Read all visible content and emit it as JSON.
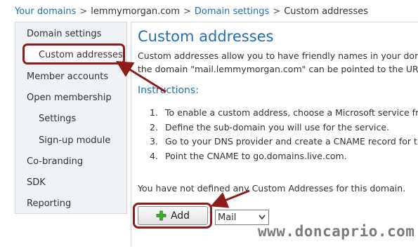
{
  "breadcrumb": {
    "your_domains": "Your domains",
    "sep1": ">",
    "domain": "lemmymorgan.com",
    "sep2": ">",
    "domain_settings": "Domain settings",
    "sep3": ">",
    "current": "Custom addresses"
  },
  "sidebar": {
    "items": [
      {
        "label": "Domain settings"
      },
      {
        "label": "Custom addresses"
      },
      {
        "label": "Member accounts"
      },
      {
        "label": "Open membership"
      },
      {
        "label": "Settings"
      },
      {
        "label": "Sign-up module"
      },
      {
        "label": "Co-branding"
      },
      {
        "label": "SDK"
      },
      {
        "label": "Reporting"
      }
    ],
    "selected": "Custom addresses"
  },
  "main": {
    "title": "Custom addresses",
    "description_line1": "Custom addresses allow you to have friendly names in your domain to",
    "description_line2": "the domain \"mail.lemmymorgan.com\" can be pointed to the URL whe",
    "instructions_title": "Instructions:",
    "steps": [
      {
        "num": "1.",
        "text": "To enable a custom address, choose a Microsoft service from"
      },
      {
        "num": "2.",
        "text": "Define the sub-domain you will use for the service."
      },
      {
        "num": "3.",
        "text": "Go to your DNS provider and create a CNAME record for the"
      },
      {
        "num": "4.",
        "text": "Point the CNAME to go.domains.live.com."
      }
    ],
    "empty_message": "You have not defined any Custom Addresses for this domain.",
    "add_label": "Add",
    "service_select": "Mail"
  },
  "watermark": "www.doncaprio.com",
  "colors": {
    "link": "#1f6fb5",
    "annotation": "#8e1c1c",
    "sidebar_bg": "#eef1f5",
    "plus_icon": "#3fae2a"
  },
  "icons": {
    "add": "plus-icon",
    "select": "chevron-down-icon"
  }
}
